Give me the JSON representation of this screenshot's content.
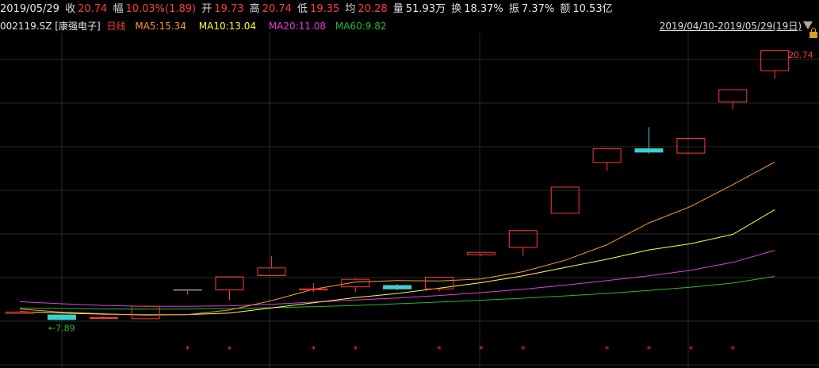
{
  "header": {
    "date": "2019/05/29",
    "close_label": "收",
    "close": "20.74",
    "change_label": "幅",
    "change": "10.03%(1.89)",
    "open_label": "开",
    "open": "19.73",
    "high_label": "高",
    "high": "20.74",
    "low_label": "低",
    "low": "19.35",
    "avg_label": "均",
    "avg": "20.28",
    "volume_label": "量",
    "volume": "51.93万",
    "turnover_label": "换",
    "turnover": "18.37%",
    "amplitude_label": "振",
    "amplitude": "7.37%",
    "amount_label": "额",
    "amount": "10.53亿"
  },
  "subheader": {
    "code": "002119.SZ",
    "name": "[康强电子]",
    "period": "日线",
    "ma5": "MA5:15.34",
    "ma10": "MA10:13.04",
    "ma20": "MA20:11.08",
    "ma60": "MA60:9.82",
    "range": "2019/04/30-2019/05/29(19日)"
  },
  "colors": {
    "up": "#ff3b3b",
    "down": "#3ed0d0",
    "ma5": "#ff9a2e",
    "ma10": "#ffff44",
    "ma20": "#e040e0",
    "ma60": "#22bb33",
    "grid": "#2a2a2a"
  },
  "chart_data": {
    "type": "candlestick",
    "ylim": [
      7.2,
      21.4
    ],
    "candles": [
      {
        "open": 8.02,
        "close": 8.12,
        "high": 8.12,
        "low": 8.02
      },
      {
        "open": 7.98,
        "close": 7.72,
        "high": 7.98,
        "low": 7.72
      },
      {
        "open": 7.78,
        "close": 7.85,
        "high": 7.9,
        "low": 7.78
      },
      {
        "open": 7.76,
        "close": 8.4,
        "high": 8.42,
        "low": 7.76
      },
      {
        "open": 9.16,
        "close": 9.16,
        "high": 9.16,
        "low": 8.94
      },
      {
        "open": 9.15,
        "close": 9.82,
        "high": 9.82,
        "low": 8.68
      },
      {
        "open": 9.84,
        "close": 10.25,
        "high": 10.8,
        "low": 10.02
      },
      {
        "open": 9.15,
        "close": 9.24,
        "high": 9.5,
        "low": 9.06
      },
      {
        "open": 9.3,
        "close": 9.7,
        "high": 9.75,
        "low": 9.05
      },
      {
        "open": 9.4,
        "close": 9.2,
        "high": 9.45,
        "low": 9.15
      },
      {
        "open": 9.2,
        "close": 9.8,
        "high": 9.8,
        "low": 9.1
      },
      {
        "open": 10.85,
        "close": 11.0,
        "high": 11.0,
        "low": 10.8
      },
      {
        "open": 11.2,
        "close": 12.05,
        "high": 12.05,
        "low": 10.8
      },
      {
        "open": 12.85,
        "close": 14.15,
        "high": 14.15,
        "low": 12.85
      },
      {
        "open": 15.3,
        "close": 16.0,
        "high": 16.0,
        "low": 14.9
      },
      {
        "open": 16.0,
        "close": 15.8,
        "high": 17.02,
        "low": 15.75
      },
      {
        "open": 15.75,
        "close": 16.5,
        "high": 16.5,
        "low": 15.75
      },
      {
        "open": 18.22,
        "close": 18.85,
        "high": 18.85,
        "low": 17.9
      },
      {
        "open": 19.73,
        "close": 20.74,
        "high": 20.74,
        "low": 19.35
      }
    ],
    "ma5": [
      8.25,
      8.1,
      8.02,
      7.95,
      7.98,
      8.2,
      8.65,
      9.2,
      9.55,
      9.62,
      9.6,
      9.7,
      10.05,
      10.6,
      11.35,
      12.4,
      13.2,
      14.25,
      15.34
    ],
    "ma10": [
      8.12,
      8.05,
      8.0,
      7.97,
      7.98,
      8.05,
      8.3,
      8.55,
      8.8,
      9.0,
      9.25,
      9.52,
      9.85,
      10.25,
      10.65,
      11.1,
      11.4,
      11.85,
      13.04
    ],
    "ma20": [
      8.6,
      8.5,
      8.42,
      8.38,
      8.38,
      8.4,
      8.48,
      8.58,
      8.68,
      8.78,
      8.9,
      9.04,
      9.2,
      9.4,
      9.62,
      9.85,
      10.12,
      10.5,
      11.08
    ],
    "ma60": [
      8.3,
      8.27,
      8.25,
      8.24,
      8.25,
      8.27,
      8.31,
      8.36,
      8.42,
      8.5,
      8.58,
      8.67,
      8.77,
      8.88,
      9.0,
      9.14,
      9.3,
      9.5,
      9.82
    ],
    "max_label": "20.74",
    "min_label": "7.89",
    "markers": [
      false,
      false,
      false,
      false,
      true,
      true,
      false,
      true,
      true,
      false,
      true,
      true,
      true,
      false,
      true,
      true,
      true,
      true,
      false
    ]
  }
}
